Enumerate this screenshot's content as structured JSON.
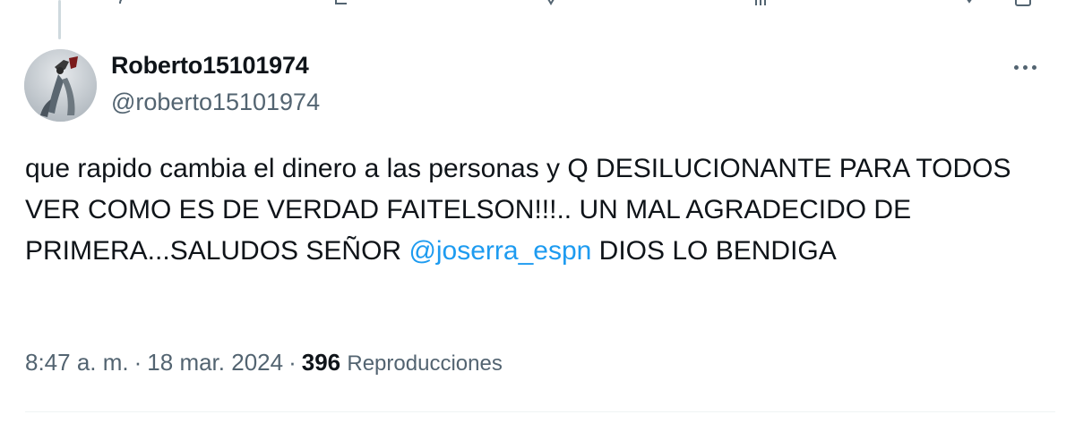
{
  "tweet": {
    "display_name": "Roberto15101974",
    "handle": "@roberto15101974",
    "text_before_mention": "que rapido cambia el dinero a las personas y Q DESILUCIONANTE PARA TODOS VER COMO ES DE VERDAD FAITELSON!!!.. UN MAL AGRADECIDO DE PRIMERA...SALUDOS SEÑOR ",
    "mention": "@joserra_espn",
    "text_after_mention": " DIOS LO BENDIGA",
    "time": "8:47 a. m.",
    "date": "18 mar. 2024",
    "separator": "·",
    "views_count": "396",
    "views_label": "Reproducciones"
  },
  "icons": {
    "more": "more-horizontal-icon",
    "avatar": "avatar-image"
  },
  "colors": {
    "link": "#1d9bf0",
    "secondary_text": "#536471",
    "primary_text": "#0f1419",
    "divider": "#eff3f4"
  }
}
